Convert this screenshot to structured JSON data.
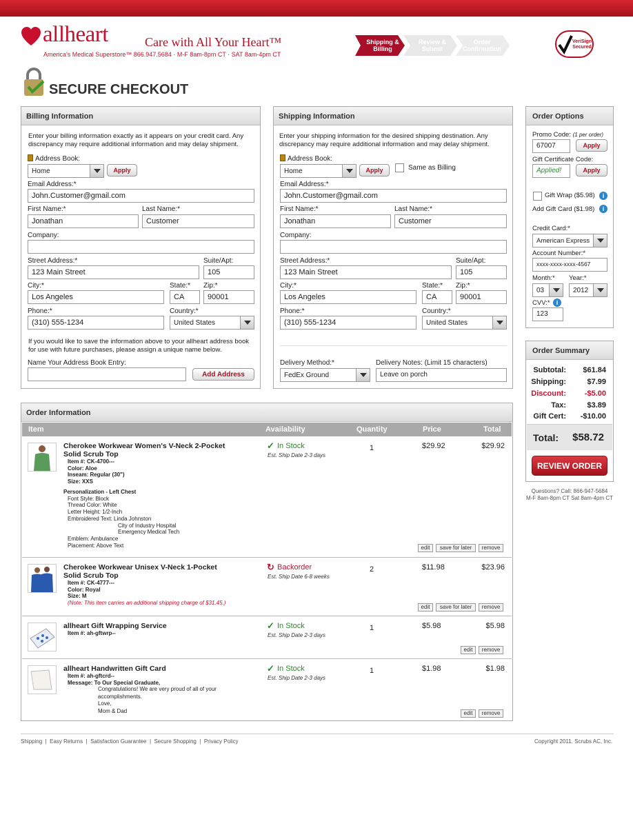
{
  "header": {
    "brand": "allheart",
    "tagline": "Care with All Your Heart™",
    "subtag": "America's Medical Superstore™  866.947.5684 · M-F 8am-8pm CT · SAT 8am-4pm CT",
    "steps": [
      "Shipping & Billing",
      "Review & Submit",
      "Order Confirmation"
    ],
    "verisign": "VeriSign Secured",
    "page_title": "SECURE CHECKOUT"
  },
  "billing": {
    "title": "Billing Information",
    "intro": "Enter your billing information exactly as it appears on your credit card. Any discrepancy may require additional information and may delay shipment.",
    "address_book_label": "Address Book:",
    "address_book_value": "Home",
    "apply": "Apply",
    "email_label": "Email Address:*",
    "email": "John.Customer@gmail.com",
    "first_label": "First Name:*",
    "first": "Jonathan",
    "last_label": "Last Name:*",
    "last": "Customer",
    "company_label": "Company:",
    "company": "",
    "street_label": "Street Address:*",
    "street": "123 Main Street",
    "suite_label": "Suite/Apt:",
    "suite": "105",
    "city_label": "City:*",
    "city": "Los Angeles",
    "state_label": "State:*",
    "state": "CA",
    "zip_label": "Zip:*",
    "zip": "90001",
    "phone_label": "Phone:*",
    "phone": "(310) 555-1234",
    "country_label": "Country:*",
    "country": "United States",
    "save_note": "If you would like to save the information above to your allheart address book for use with future purchases, please assign a unique name below.",
    "entry_label": "Name Your Address Book Entry:",
    "add_address": "Add Address"
  },
  "shipping": {
    "title": "Shipping Information",
    "intro": "Enter your shipping information for the desired shipping destination. Any discrepancy may require additional information and may delay shipment.",
    "address_book_label": "Address Book:",
    "address_book_value": "Home",
    "apply": "Apply",
    "same_as_billing": "Same as Billing",
    "email_label": "Email Address:*",
    "email": "John.Customer@gmail.com",
    "first_label": "First Name:*",
    "first": "Jonathan",
    "last_label": "Last Name:*",
    "last": "Customer",
    "company_label": "Company:",
    "street_label": "Street Address:*",
    "street": "123 Main Street",
    "suite_label": "Suite/Apt:",
    "suite": "105",
    "city_label": "City:*",
    "city": "Los Angeles",
    "state_label": "State:*",
    "state": "CA",
    "zip_label": "Zip:*",
    "zip": "90001",
    "phone_label": "Phone:*",
    "phone": "(310) 555-1234",
    "country_label": "Country:*",
    "country": "United States",
    "delivery_label": "Delivery Method:*",
    "delivery": "FedEx Ground",
    "notes_label": "Delivery Notes: (Limit 15 characters)",
    "notes": "Leave on porch"
  },
  "options": {
    "title": "Order Options",
    "promo_label": "Promo Code:",
    "promo_note": "(1 per order)",
    "promo": "67007",
    "apply": "Apply",
    "gift_cert_label": "Gift Certificate Code:",
    "gift_cert": "Applied!",
    "gift_wrap": "Gift Wrap ($5.98)",
    "gift_card": "Add Gift Card ($1.98)",
    "cc_label": "Credit Card:*",
    "cc": "American Express",
    "acct_label": "Account Number:*",
    "acct": "xxxx-xxxx-xxxx-4567",
    "month_label": "Month:*",
    "month": "03",
    "year_label": "Year:*",
    "year": "2012",
    "cvv_label": "CVV:*",
    "cvv": "123"
  },
  "summary": {
    "title": "Order Summary",
    "rows": [
      {
        "label": "Subtotal:",
        "value": "$61.84"
      },
      {
        "label": "Shipping:",
        "value": "$7.99"
      },
      {
        "label": "Discount:",
        "value": "-$5.00"
      },
      {
        "label": "Tax:",
        "value": "$3.89"
      },
      {
        "label": "Gift Cert:",
        "value": "-$10.00"
      }
    ],
    "total_label": "Total:",
    "total": "$58.72",
    "review": "REVIEW ORDER",
    "questions": "Questions? Call: 866-947-5684",
    "hours": "M-F 8am-8pm CT Sat 8am-4pm CT",
    "discount_color": "#c8102e"
  },
  "order": {
    "title": "Order Information",
    "columns": [
      "Item",
      "Availability",
      "Quantity",
      "Price",
      "Total"
    ],
    "items": [
      {
        "name1": "Cherokee Workwear Women's V-Neck 2-Pocket",
        "name2": "Solid Scrub Top",
        "details": [
          "Item #:  CK-4700---",
          "Color:  Aloe",
          "Inseam:  Regular (30\")",
          "Size:  XXS"
        ],
        "extra": [
          "Personalization - Left Chest",
          "Font Style:  Block",
          "Thread Color:  White",
          "Letter Height:  1/2-Inch",
          "Embroidered Text:  Linda Johnston",
          "City of Industry Hospital",
          "Emergency Medical Tech",
          "Emblem:  Ambulance",
          "Placement:  Above Text"
        ],
        "status": "In Stock",
        "ship": "Est. Ship Date 2-3 days",
        "qty": "1",
        "price": "$29.92",
        "total": "$29.92",
        "actions": [
          "edit",
          "save for later",
          "remove"
        ]
      },
      {
        "name1": "Cherokee Workwear Unisex V-Neck 1-Pocket",
        "name2": "Solid Scrub Top",
        "details": [
          "Item #:  CK-4777---",
          "Color:  Royal",
          "Size:  M"
        ],
        "note": "(Note: This item carries an additional shipping charge of $31.45.)",
        "status": "Backorder",
        "ship": "Est. Ship Date 6-8 weeks",
        "qty": "2",
        "price": "$11.98",
        "total": "$23.96",
        "actions": [
          "edit",
          "save for later",
          "remove"
        ]
      },
      {
        "name1": "allheart Gift Wrapping Service",
        "details": [
          "Item #:  ah-gftwrp--"
        ],
        "status": "In Stock",
        "ship": "Est. Ship Date 2-3 days",
        "qty": "1",
        "price": "$5.98",
        "total": "$5.98",
        "actions": [
          "edit",
          "remove"
        ]
      },
      {
        "name1": "allheart Handwritten Gift Card",
        "details": [
          "Item #:  ah-gftcrd--",
          "Message:  To Our Special Graduate,"
        ],
        "message": [
          "Congratulations!  We are very proud of all of your",
          "accomplishments.",
          "Love,",
          "Mom & Dad"
        ],
        "status": "In Stock",
        "ship": "Est. Ship Date 2-3 days",
        "qty": "1",
        "price": "$1.98",
        "total": "$1.98",
        "actions": [
          "edit",
          "remove"
        ]
      }
    ]
  },
  "footer": {
    "links": [
      "Shipping",
      "Easy Returns",
      "Satisfaction Guarantee",
      "Secure Shopping",
      "Privacy Policy"
    ],
    "copyright": "Copyright 2011. Scrubs AC, Inc."
  },
  "colors": {
    "brand": "#c8102e",
    "in_stock": "#2a8a2a"
  }
}
